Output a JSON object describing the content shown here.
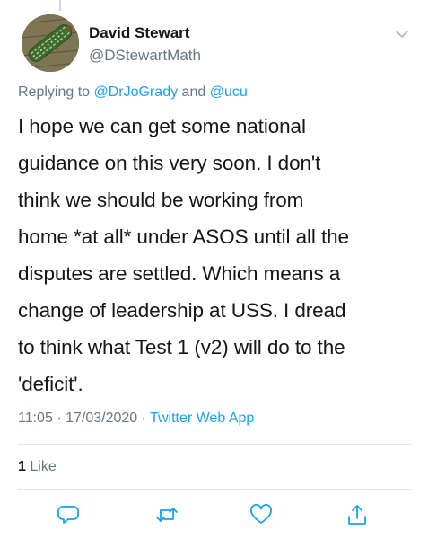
{
  "tweet": {
    "author_name": "David Stewart",
    "author_handle": "@DStewartMath",
    "replying_prefix": "Replying to",
    "replying_to_1": "@DrJoGrady",
    "replying_and": "and",
    "replying_to_2": "@ucu",
    "text_lines": [
      "I hope we can get some national",
      "guidance on this very soon. I don't",
      "think we should be working from",
      "home *at all* under ASOS until all the",
      "disputes are settled. Which means a",
      "change of leadership at USS. I dread",
      "to think what Test 1 (v2) will do to the",
      "'deficit'."
    ],
    "time": "11:05",
    "date": "17/03/2020",
    "separator": "·",
    "source": "Twitter Web App",
    "like_count": "1",
    "like_label": "Like"
  },
  "icons": {
    "caret": "chevron-down-icon",
    "reply": "reply-icon",
    "retweet": "retweet-icon",
    "like": "heart-icon",
    "share": "share-icon"
  },
  "colors": {
    "text": "#14171a",
    "secondary": "#657786",
    "link": "#1da1f2",
    "divider": "#e1e8ed"
  }
}
